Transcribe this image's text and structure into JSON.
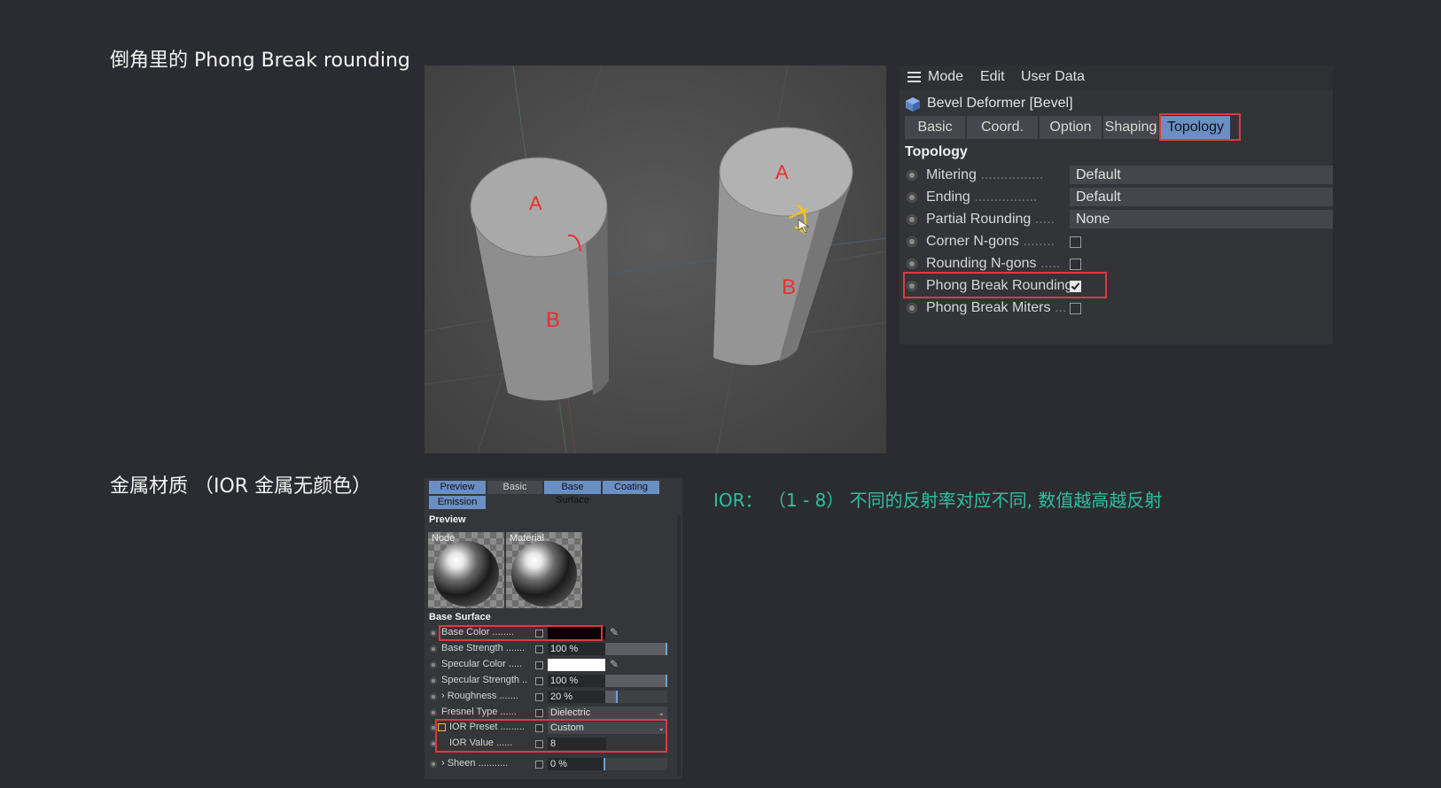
{
  "headings": {
    "top": "倒角里的 Phong Break rounding",
    "bottom": "金属材质 （IOR 金属无颜色）"
  },
  "viewport": {
    "labels": {
      "top": "A",
      "side": "B"
    }
  },
  "attribute_manager": {
    "menu": [
      "Mode",
      "Edit",
      "User Data"
    ],
    "object_title": "Bevel Deformer [Bevel]",
    "tabs": [
      "Basic",
      "Coord.",
      "Option",
      "Shaping",
      "Topology"
    ],
    "active_tab": "Topology",
    "section": "Topology",
    "params": [
      {
        "label": "Mitering",
        "dots": "................",
        "type": "dropdown",
        "value": "Default"
      },
      {
        "label": "Ending",
        "dots": "................",
        "type": "dropdown",
        "value": "Default"
      },
      {
        "label": "Partial Rounding",
        "dots": ".....",
        "type": "dropdown",
        "value": "None"
      },
      {
        "label": "Corner N-gons",
        "dots": "........",
        "type": "checkbox",
        "checked": false
      },
      {
        "label": "Rounding N-gons",
        "dots": ".....",
        "type": "checkbox",
        "checked": false
      },
      {
        "label": "Phong Break Rounding",
        "dots": "",
        "type": "checkbox",
        "checked": true
      },
      {
        "label": "Phong Break Miters",
        "dots": "...",
        "type": "checkbox",
        "checked": false
      }
    ]
  },
  "material_panel": {
    "tabs": [
      "Preview",
      "Basic",
      "Base Surface",
      "Coating",
      "Emission"
    ],
    "preview_heading": "Preview",
    "thumb_labels": [
      "Node",
      "Material"
    ],
    "base_surface_heading": "Base Surface",
    "rows": [
      {
        "label": "Base Color",
        "dots": "........",
        "kind": "color",
        "color": "#0a0000"
      },
      {
        "label": "Base Strength",
        "dots": ".......",
        "kind": "slider",
        "value": "100 %",
        "fraction": 1.0
      },
      {
        "label": "Specular Color",
        "dots": ".....",
        "kind": "color",
        "color": "#ffffff"
      },
      {
        "label": "Specular Strength",
        "dots": "..",
        "kind": "slider",
        "value": "100 %",
        "fraction": 1.0
      },
      {
        "label": "› Roughness",
        "dots": ".......",
        "kind": "slider",
        "value": "20 %",
        "fraction": 0.2
      },
      {
        "label": "Fresnel Type",
        "dots": "......",
        "kind": "dropdown",
        "value": "Dielectric"
      },
      {
        "label": "IOR Preset",
        "dots": ".........",
        "kind": "dropdown",
        "value": "Custom"
      },
      {
        "label": "IOR Value",
        "dots": "......",
        "kind": "number",
        "value": "8"
      },
      {
        "label": "› Sheen",
        "dots": "...........",
        "kind": "slider",
        "value": "0 %",
        "fraction": 0.0
      }
    ]
  },
  "ior_note": "IOR：  （1 - 8） 不同的反射率对应不同, 数值越高越反射",
  "colors": {
    "background": "#2b2c31",
    "accent_tab": "#6a8fc2",
    "highlight_box": "#e03a3a",
    "note_text": "#2fbf9f",
    "annotation_red": "#e83030",
    "gizmo_yellow": "#f2c21b"
  }
}
